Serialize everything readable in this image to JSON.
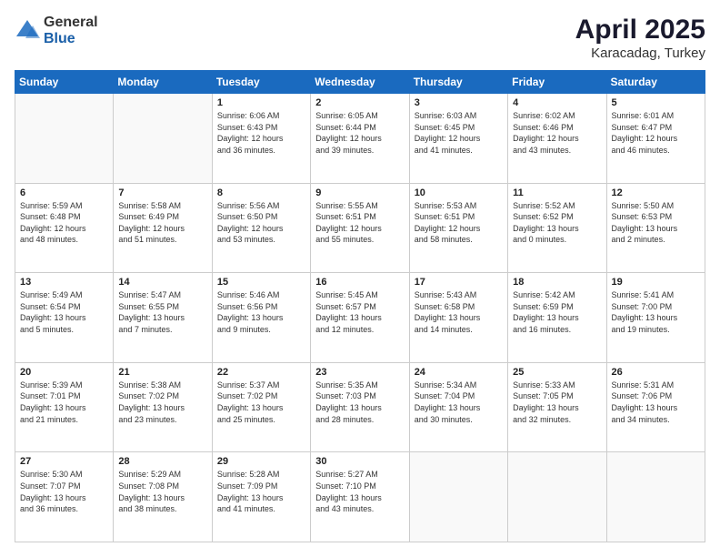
{
  "logo": {
    "general": "General",
    "blue": "Blue"
  },
  "header": {
    "month": "April 2025",
    "location": "Karacadag, Turkey"
  },
  "weekdays": [
    "Sunday",
    "Monday",
    "Tuesday",
    "Wednesday",
    "Thursday",
    "Friday",
    "Saturday"
  ],
  "weeks": [
    [
      {
        "day": "",
        "info": ""
      },
      {
        "day": "",
        "info": ""
      },
      {
        "day": "1",
        "info": "Sunrise: 6:06 AM\nSunset: 6:43 PM\nDaylight: 12 hours\nand 36 minutes."
      },
      {
        "day": "2",
        "info": "Sunrise: 6:05 AM\nSunset: 6:44 PM\nDaylight: 12 hours\nand 39 minutes."
      },
      {
        "day": "3",
        "info": "Sunrise: 6:03 AM\nSunset: 6:45 PM\nDaylight: 12 hours\nand 41 minutes."
      },
      {
        "day": "4",
        "info": "Sunrise: 6:02 AM\nSunset: 6:46 PM\nDaylight: 12 hours\nand 43 minutes."
      },
      {
        "day": "5",
        "info": "Sunrise: 6:01 AM\nSunset: 6:47 PM\nDaylight: 12 hours\nand 46 minutes."
      }
    ],
    [
      {
        "day": "6",
        "info": "Sunrise: 5:59 AM\nSunset: 6:48 PM\nDaylight: 12 hours\nand 48 minutes."
      },
      {
        "day": "7",
        "info": "Sunrise: 5:58 AM\nSunset: 6:49 PM\nDaylight: 12 hours\nand 51 minutes."
      },
      {
        "day": "8",
        "info": "Sunrise: 5:56 AM\nSunset: 6:50 PM\nDaylight: 12 hours\nand 53 minutes."
      },
      {
        "day": "9",
        "info": "Sunrise: 5:55 AM\nSunset: 6:51 PM\nDaylight: 12 hours\nand 55 minutes."
      },
      {
        "day": "10",
        "info": "Sunrise: 5:53 AM\nSunset: 6:51 PM\nDaylight: 12 hours\nand 58 minutes."
      },
      {
        "day": "11",
        "info": "Sunrise: 5:52 AM\nSunset: 6:52 PM\nDaylight: 13 hours\nand 0 minutes."
      },
      {
        "day": "12",
        "info": "Sunrise: 5:50 AM\nSunset: 6:53 PM\nDaylight: 13 hours\nand 2 minutes."
      }
    ],
    [
      {
        "day": "13",
        "info": "Sunrise: 5:49 AM\nSunset: 6:54 PM\nDaylight: 13 hours\nand 5 minutes."
      },
      {
        "day": "14",
        "info": "Sunrise: 5:47 AM\nSunset: 6:55 PM\nDaylight: 13 hours\nand 7 minutes."
      },
      {
        "day": "15",
        "info": "Sunrise: 5:46 AM\nSunset: 6:56 PM\nDaylight: 13 hours\nand 9 minutes."
      },
      {
        "day": "16",
        "info": "Sunrise: 5:45 AM\nSunset: 6:57 PM\nDaylight: 13 hours\nand 12 minutes."
      },
      {
        "day": "17",
        "info": "Sunrise: 5:43 AM\nSunset: 6:58 PM\nDaylight: 13 hours\nand 14 minutes."
      },
      {
        "day": "18",
        "info": "Sunrise: 5:42 AM\nSunset: 6:59 PM\nDaylight: 13 hours\nand 16 minutes."
      },
      {
        "day": "19",
        "info": "Sunrise: 5:41 AM\nSunset: 7:00 PM\nDaylight: 13 hours\nand 19 minutes."
      }
    ],
    [
      {
        "day": "20",
        "info": "Sunrise: 5:39 AM\nSunset: 7:01 PM\nDaylight: 13 hours\nand 21 minutes."
      },
      {
        "day": "21",
        "info": "Sunrise: 5:38 AM\nSunset: 7:02 PM\nDaylight: 13 hours\nand 23 minutes."
      },
      {
        "day": "22",
        "info": "Sunrise: 5:37 AM\nSunset: 7:02 PM\nDaylight: 13 hours\nand 25 minutes."
      },
      {
        "day": "23",
        "info": "Sunrise: 5:35 AM\nSunset: 7:03 PM\nDaylight: 13 hours\nand 28 minutes."
      },
      {
        "day": "24",
        "info": "Sunrise: 5:34 AM\nSunset: 7:04 PM\nDaylight: 13 hours\nand 30 minutes."
      },
      {
        "day": "25",
        "info": "Sunrise: 5:33 AM\nSunset: 7:05 PM\nDaylight: 13 hours\nand 32 minutes."
      },
      {
        "day": "26",
        "info": "Sunrise: 5:31 AM\nSunset: 7:06 PM\nDaylight: 13 hours\nand 34 minutes."
      }
    ],
    [
      {
        "day": "27",
        "info": "Sunrise: 5:30 AM\nSunset: 7:07 PM\nDaylight: 13 hours\nand 36 minutes."
      },
      {
        "day": "28",
        "info": "Sunrise: 5:29 AM\nSunset: 7:08 PM\nDaylight: 13 hours\nand 38 minutes."
      },
      {
        "day": "29",
        "info": "Sunrise: 5:28 AM\nSunset: 7:09 PM\nDaylight: 13 hours\nand 41 minutes."
      },
      {
        "day": "30",
        "info": "Sunrise: 5:27 AM\nSunset: 7:10 PM\nDaylight: 13 hours\nand 43 minutes."
      },
      {
        "day": "",
        "info": ""
      },
      {
        "day": "",
        "info": ""
      },
      {
        "day": "",
        "info": ""
      }
    ]
  ]
}
